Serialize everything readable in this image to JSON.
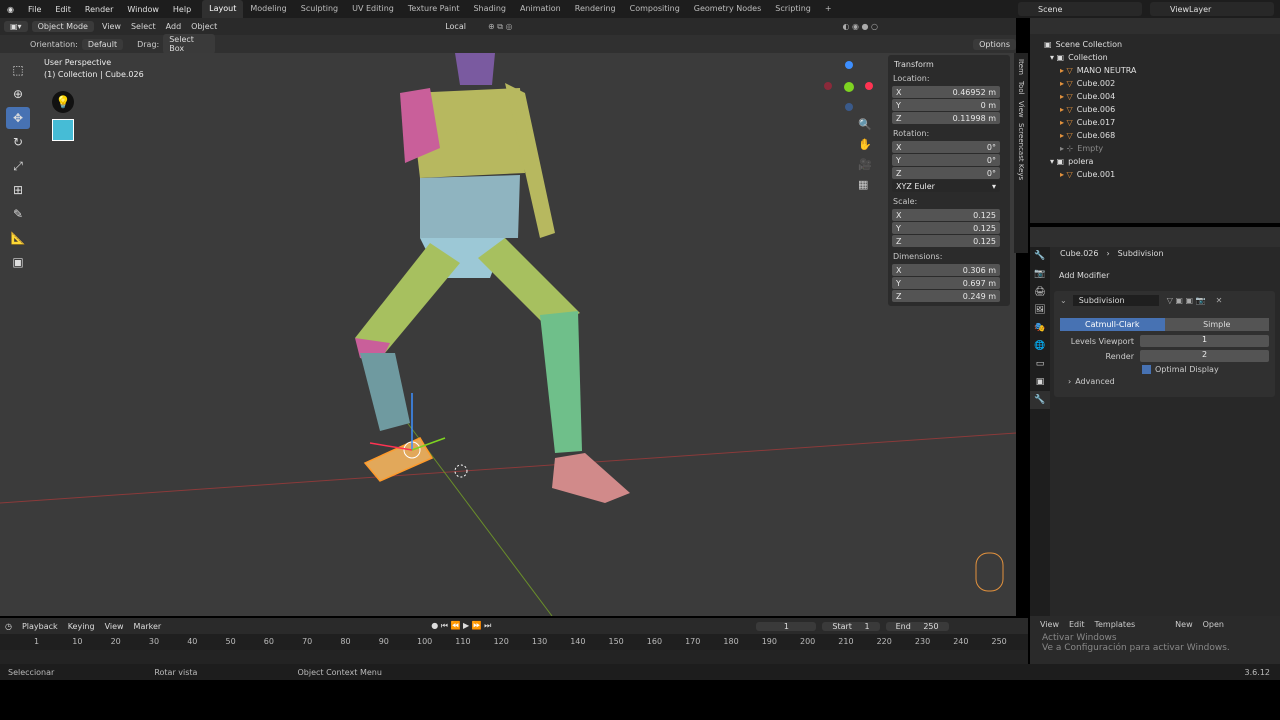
{
  "menu": [
    "File",
    "Edit",
    "Render",
    "Window",
    "Help"
  ],
  "workspaces": [
    "Layout",
    "Modeling",
    "Sculpting",
    "UV Editing",
    "Texture Paint",
    "Shading",
    "Animation",
    "Rendering",
    "Compositing",
    "Geometry Nodes",
    "Scripting"
  ],
  "active_workspace": "Layout",
  "scene": "Scene",
  "view_layer": "ViewLayer",
  "header": {
    "mode": "Object Mode",
    "view": "View",
    "select": "Select",
    "add": "Add",
    "object": "Object",
    "pivot": "Local",
    "options": "Options"
  },
  "tool_settings": {
    "orientation_label": "Orientation:",
    "orientation": "Default",
    "drag_label": "Drag:",
    "drag": "Select Box"
  },
  "viewport": {
    "perspective": "User Perspective",
    "collection": "(1) Collection | Cube.026"
  },
  "transform": {
    "title": "Transform",
    "location_label": "Location:",
    "location": {
      "x": "0.46952 m",
      "y": "0 m",
      "z": "0.11998 m"
    },
    "rotation_label": "Rotation:",
    "rotation": {
      "x": "0°",
      "y": "0°",
      "z": "0°"
    },
    "rotation_mode": "XYZ Euler",
    "scale_label": "Scale:",
    "scale": {
      "x": "0.125",
      "y": "0.125",
      "z": "0.125"
    },
    "dimensions_label": "Dimensions:",
    "dimensions": {
      "x": "0.306 m",
      "y": "0.697 m",
      "z": "0.249 m"
    }
  },
  "ntabs": [
    "Item",
    "Tool",
    "View",
    "Screencast Keys"
  ],
  "outliner": {
    "root": "Scene Collection",
    "rows": [
      {
        "name": "Collection",
        "level": 1,
        "kind": "collection"
      },
      {
        "name": "MANO NEUTRA",
        "level": 2,
        "kind": "object"
      },
      {
        "name": "Cube.002",
        "level": 2,
        "kind": "object"
      },
      {
        "name": "Cube.004",
        "level": 2,
        "kind": "object"
      },
      {
        "name": "Cube.006",
        "level": 2,
        "kind": "object"
      },
      {
        "name": "Cube.017",
        "level": 2,
        "kind": "object"
      },
      {
        "name": "Cube.068",
        "level": 2,
        "kind": "object"
      },
      {
        "name": "Empty",
        "level": 2,
        "kind": "empty"
      },
      {
        "name": "polera",
        "level": 1,
        "kind": "collection"
      },
      {
        "name": "Cube.001",
        "level": 2,
        "kind": "object"
      }
    ]
  },
  "properties": {
    "object": "Cube.026",
    "modifier_crumb": "Subdivision",
    "add_modifier": "Add Modifier",
    "modifier_name": "Subdivision",
    "type_a": "Catmull-Clark",
    "type_b": "Simple",
    "levels_viewport_label": "Levels Viewport",
    "levels_viewport": "1",
    "render_label": "Render",
    "render": "2",
    "optimal_display": "Optimal Display",
    "advanced": "Advanced"
  },
  "timeline": {
    "menu": [
      "Playback",
      "Keying",
      "View",
      "Marker"
    ],
    "current_frame": "1",
    "start_label": "Start",
    "start": "1",
    "end_label": "End",
    "end": "250",
    "ticks": [
      "1",
      "10",
      "20",
      "30",
      "40",
      "50",
      "60",
      "70",
      "80",
      "90",
      "100",
      "110",
      "120",
      "130",
      "140",
      "150",
      "160",
      "170",
      "180",
      "190",
      "200",
      "210",
      "220",
      "230",
      "240",
      "250"
    ]
  },
  "status": {
    "left": "Seleccionar",
    "middle": "Rotar vista",
    "right": "Object Context Menu",
    "version": "3.6.12"
  },
  "bottom_right": {
    "view": "View",
    "edit": "Edit",
    "templates": "Templates",
    "new": "New",
    "open": "Open"
  },
  "watermark": {
    "line1": "Activar Windows",
    "line2": "Ve a Configuración para activar Windows."
  }
}
